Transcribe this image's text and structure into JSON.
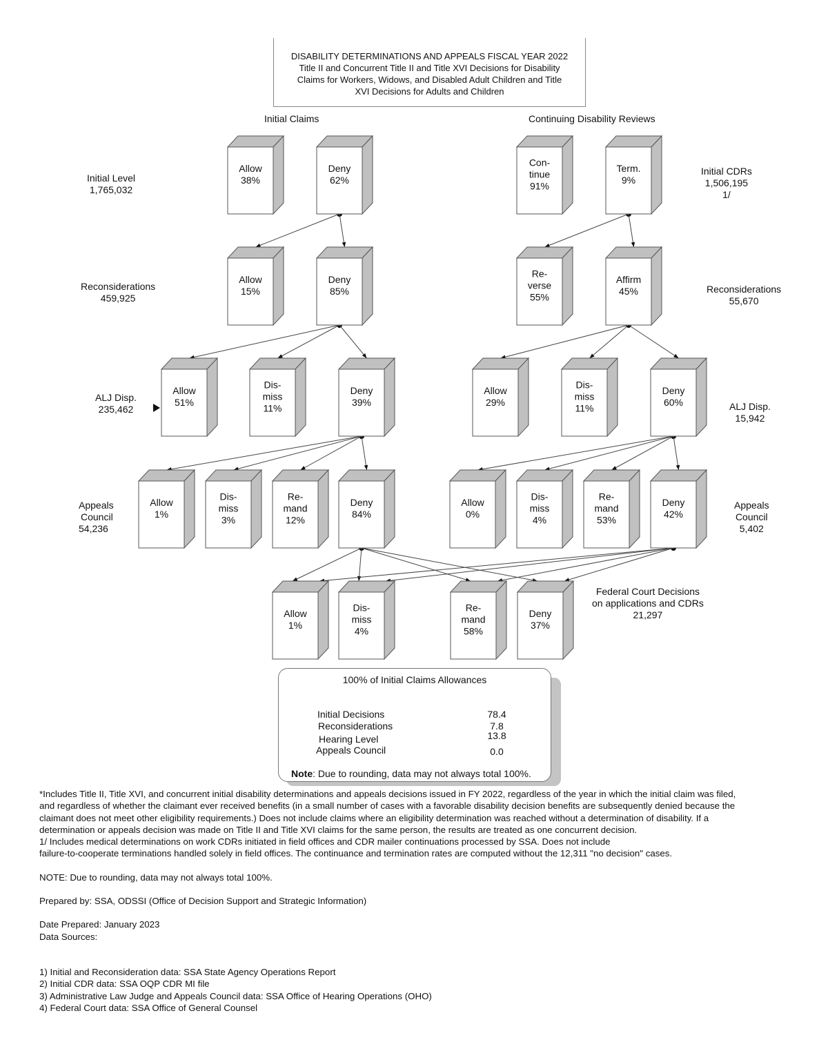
{
  "header": {
    "title_lines": [
      "DISABILITY DETERMINATIONS AND APPEALS FISCAL YEAR 2022",
      "Title II and Concurrent Title II and Title XVI Decisions for Disability",
      "Claims for Workers, Widows, and Disabled Adult Children and Title",
      "XVI Decisions for Adults and Children"
    ]
  },
  "columns": {
    "initial_claims": "Initial Claims",
    "cdr": "Continuing Disability Reviews"
  },
  "levels": {
    "initial_level": [
      "Initial Level",
      "1,765,032"
    ],
    "ic_recon": [
      "Reconsiderations",
      "459,925"
    ],
    "ic_alj": [
      "ALJ Disp.",
      "235,462"
    ],
    "ic_ac": [
      "Appeals",
      "Council",
      "54,236"
    ],
    "cdr_initial": [
      "Initial CDRs",
      "1,506,195",
      "1/"
    ],
    "cdr_recon": [
      "Reconsiderations",
      "55,670"
    ],
    "cdr_alj": [
      "ALJ Disp.",
      "15,942"
    ],
    "cdr_ac": [
      "Appeals",
      "Council",
      "5,402"
    ],
    "federal": [
      "Federal Court Decisions",
      "on applications and CDRs",
      "21,297"
    ]
  },
  "boxes": [
    {
      "id": "ic-init-allow",
      "lines": [
        "Allow",
        "38%"
      ]
    },
    {
      "id": "ic-init-deny",
      "lines": [
        "Deny",
        "62%"
      ]
    },
    {
      "id": "ic-recon-allow",
      "lines": [
        "Allow",
        "15%"
      ]
    },
    {
      "id": "ic-recon-deny",
      "lines": [
        "Deny",
        "85%"
      ]
    },
    {
      "id": "ic-alj-allow",
      "lines": [
        "Allow",
        "51%"
      ]
    },
    {
      "id": "ic-alj-dismiss",
      "lines": [
        "Dis-",
        "miss",
        "11%"
      ]
    },
    {
      "id": "ic-alj-deny",
      "lines": [
        "Deny",
        "39%"
      ]
    },
    {
      "id": "ic-ac-allow",
      "lines": [
        "Allow",
        "1%"
      ]
    },
    {
      "id": "ic-ac-dismiss",
      "lines": [
        "Dis-",
        "miss",
        "3%"
      ]
    },
    {
      "id": "ic-ac-remand",
      "lines": [
        "Re-",
        "mand",
        "12%"
      ]
    },
    {
      "id": "ic-ac-deny",
      "lines": [
        "Deny",
        "84%"
      ]
    },
    {
      "id": "cdr-init-continue",
      "lines": [
        "Con-",
        "tinue",
        "91%"
      ]
    },
    {
      "id": "cdr-init-term",
      "lines": [
        "Term.",
        "9%"
      ]
    },
    {
      "id": "cdr-recon-reverse",
      "lines": [
        "Re-",
        "verse",
        "55%"
      ]
    },
    {
      "id": "cdr-recon-affirm",
      "lines": [
        "Affirm",
        "45%"
      ]
    },
    {
      "id": "cdr-alj-allow",
      "lines": [
        "Allow",
        "29%"
      ]
    },
    {
      "id": "cdr-alj-dismiss",
      "lines": [
        "Dis-",
        "miss",
        "11%"
      ]
    },
    {
      "id": "cdr-alj-deny",
      "lines": [
        "Deny",
        "60%"
      ]
    },
    {
      "id": "cdr-ac-allow",
      "lines": [
        "Allow",
        "0%"
      ]
    },
    {
      "id": "cdr-ac-dismiss",
      "lines": [
        "Dis-",
        "miss",
        "4%"
      ]
    },
    {
      "id": "cdr-ac-remand",
      "lines": [
        "Re-",
        "mand",
        "53%"
      ]
    },
    {
      "id": "cdr-ac-deny",
      "lines": [
        "Deny",
        "42%"
      ]
    },
    {
      "id": "fc-allow",
      "lines": [
        "Allow",
        "1%"
      ]
    },
    {
      "id": "fc-dismiss",
      "lines": [
        "Dis-",
        "miss",
        "4%"
      ]
    },
    {
      "id": "fc-remand",
      "lines": [
        "Re-",
        "mand",
        "58%"
      ]
    },
    {
      "id": "fc-deny",
      "lines": [
        "Deny",
        "37%"
      ]
    }
  ],
  "flows": [
    {
      "from": "ic-init-deny",
      "to": [
        "ic-recon-allow",
        "ic-recon-deny"
      ]
    },
    {
      "from": "ic-recon-deny",
      "to": [
        "ic-alj-allow",
        "ic-alj-dismiss",
        "ic-alj-deny"
      ]
    },
    {
      "from": "ic-alj-deny",
      "to": [
        "ic-ac-allow",
        "ic-ac-dismiss",
        "ic-ac-remand",
        "ic-ac-deny"
      ]
    },
    {
      "from": "ic-ac-deny",
      "to": [
        "fc-allow",
        "fc-dismiss",
        "fc-remand",
        "fc-deny"
      ]
    },
    {
      "from": "cdr-init-term",
      "to": [
        "cdr-recon-reverse",
        "cdr-recon-affirm"
      ]
    },
    {
      "from": "cdr-recon-affirm",
      "to": [
        "cdr-alj-allow",
        "cdr-alj-dismiss",
        "cdr-alj-deny"
      ]
    },
    {
      "from": "cdr-alj-deny",
      "to": [
        "cdr-ac-allow",
        "cdr-ac-dismiss",
        "cdr-ac-remand",
        "cdr-ac-deny"
      ]
    },
    {
      "from": "cdr-ac-deny",
      "to": [
        "fc-allow",
        "fc-dismiss",
        "fc-remand",
        "fc-deny"
      ]
    }
  ],
  "summary": {
    "title": "100% of Initial Claims Allowances",
    "rows": [
      {
        "label": "Initial Decisions",
        "value": "78.4"
      },
      {
        "label": "Reconsiderations",
        "value": "7.8"
      },
      {
        "label": "Hearing Level",
        "value": "13.8"
      },
      {
        "label": "Appeals Council",
        "value": "0.0"
      }
    ],
    "note_label": "Note",
    "note_text": ":  Due to rounding, data may not always total 100%."
  },
  "footer": {
    "footnote_lines": [
      "*Includes Title II, Title XVI, and concurrent initial disability determinations and appeals decisions issued in FY 2022, regardless of the year in which the initial claim was filed,",
      "and regardless of whether the claimant ever received benefits (in a small number of cases with a favorable disability decision benefits are subsequently denied because the",
      "claimant does not meet other eligibility requirements.)  Does not include claims where an eligibility determination was reached without a determination of disability.  If a",
      "determination or appeals decision was made on Title II and Title XVI claims for the same person, the results are treated as one concurrent decision.",
      "1/ Includes medical determinations on work CDRs initiated in field offices and CDR mailer continuations processed by SSA. Does not include",
      "failure-to-cooperate terminations handled solely in field offices. The continuance and termination rates are computed without the 12,311 \"no decision\" cases."
    ],
    "note": "NOTE:  Due to rounding, data may not always total 100%.",
    "prepared_by": "Prepared by: SSA, ODSSI (Office of Decision Support and Strategic Information)",
    "date_prepared": "Date Prepared: January 2023",
    "data_sources_label": "Data Sources:",
    "sources": [
      "1) Initial and Reconsideration data: SSA State Agency Operations Report",
      "2) Initial CDR data: SSA OQP CDR MI file",
      "3) Administrative Law Judge and Appeals Council data: SSA Office of Hearing Operations (OHO)",
      "4) Federal Court data: SSA Office of General Counsel"
    ]
  },
  "colors": {
    "box_side": "#c0c0c0",
    "box_stroke": "#555555",
    "line": "#444444"
  }
}
